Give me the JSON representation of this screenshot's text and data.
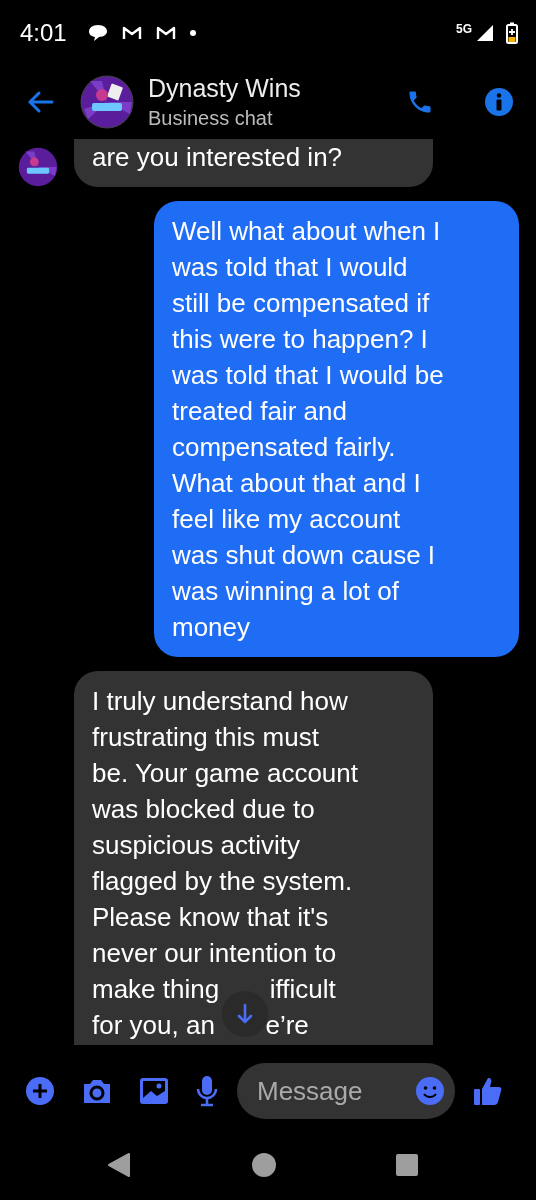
{
  "status_bar": {
    "time": "4:01",
    "network": "5G"
  },
  "header": {
    "name": "Dynasty Wins",
    "subtitle": "Business chat"
  },
  "messages": [
    {
      "kind": "incoming",
      "text": "are you interested in?",
      "avatar": true
    },
    {
      "kind": "outgoing",
      "text": "Well what about when I\nwas told that I would\nstill be compensated if\nthis were to happen? I\nwas told that I would be\ntreated fair and\ncompensated fairly.\nWhat about that and I\nfeel like my account\nwas shut down cause I\nwas winning a lot of\nmoney",
      "avatar": false
    },
    {
      "kind": "incoming",
      "text": "I truly understand how\nfrustrating this must\nbe. Your game account\nwas blocked due to\nsuspicious activity\nflagged by the system.\nPlease know that it's\nnever our intention to\nmake thing       ifficult\nfor you, an       e’re",
      "avatar": false
    }
  ],
  "composer": {
    "placeholder": "Message"
  }
}
